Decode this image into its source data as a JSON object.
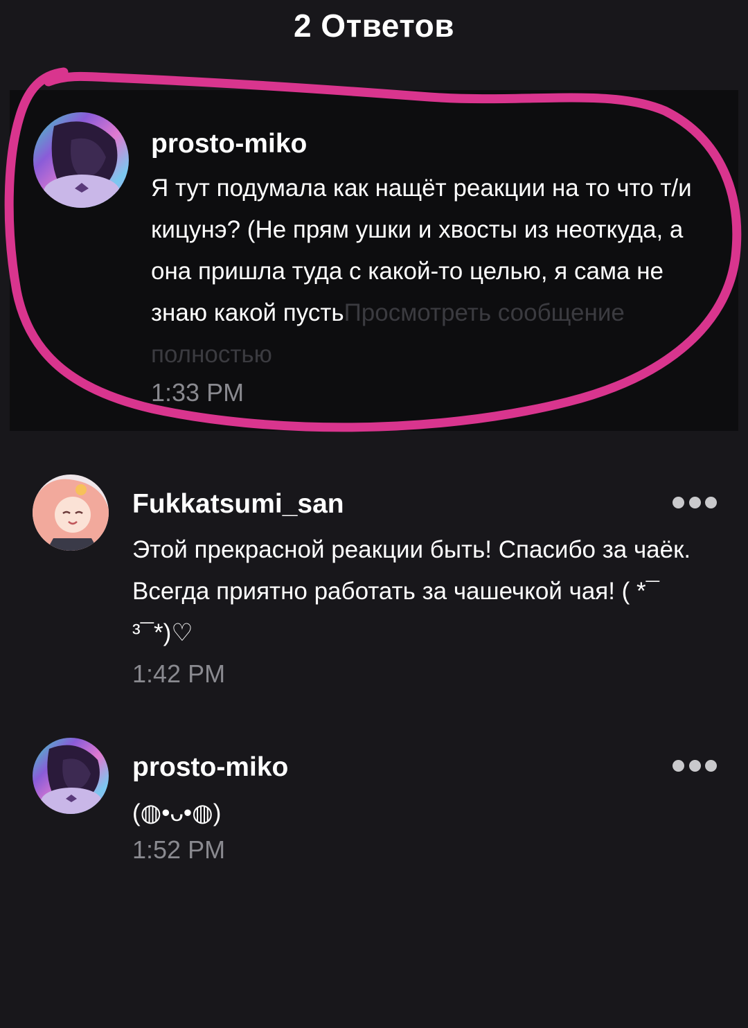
{
  "header": {
    "title": "2 Ответов"
  },
  "parent_comment": {
    "username": "prosto-miko",
    "text": "Я тут подумала как нащёт реакции на то что т/и кицунэ? (Не прям ушки и хвосты из неоткуда, а она пришла туда с какой-то целью, я сама не знаю какой пусть",
    "more_label": "Просмотреть сообщение полностью",
    "time": "1:33 PM"
  },
  "replies": [
    {
      "username": "Fukkatsumi_san",
      "text": "Этой прекрасной реакции быть! Спасибо за чаёк. Всегда приятно работать за чашечкой чая! ( *¯ ³¯*)♡",
      "time": "1:42 PM",
      "menu_icon": "more-dots-icon"
    },
    {
      "username": "prosto-miko",
      "text": "(◍•ᴗ•◍)",
      "time": "1:52 PM",
      "menu_icon": "more-dots-icon"
    }
  ],
  "colors": {
    "background": "#18171b",
    "card": "#0d0d0f",
    "timestamp": "#8a8a90",
    "more_link": "#3b3b40",
    "highlight_stroke": "#d9358e"
  }
}
